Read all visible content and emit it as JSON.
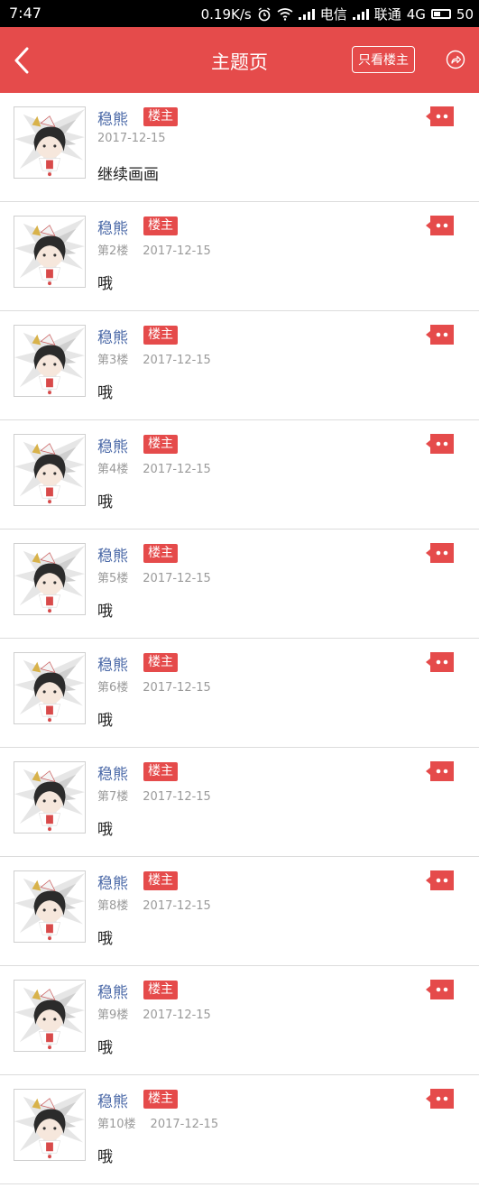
{
  "status_bar": {
    "time": "7:47",
    "speed": "0.19K/s",
    "carrier1": "电信",
    "carrier2": "联通",
    "network": "4G",
    "battery": "50"
  },
  "header": {
    "title": "主题页",
    "only_op_label": "只看楼主",
    "back_icon": "chevron-left-icon",
    "share_icon": "share-icon",
    "bar_color": "#e54b4b"
  },
  "posts": [
    {
      "author": "稳熊",
      "badge": "楼主",
      "floor": "",
      "date": "2017-12-15",
      "content": "继续画画"
    },
    {
      "author": "稳熊",
      "badge": "楼主",
      "floor": "第2楼",
      "date": "2017-12-15",
      "content": "哦"
    },
    {
      "author": "稳熊",
      "badge": "楼主",
      "floor": "第3楼",
      "date": "2017-12-15",
      "content": "哦"
    },
    {
      "author": "稳熊",
      "badge": "楼主",
      "floor": "第4楼",
      "date": "2017-12-15",
      "content": "哦"
    },
    {
      "author": "稳熊",
      "badge": "楼主",
      "floor": "第5楼",
      "date": "2017-12-15",
      "content": "哦"
    },
    {
      "author": "稳熊",
      "badge": "楼主",
      "floor": "第6楼",
      "date": "2017-12-15",
      "content": "哦"
    },
    {
      "author": "稳熊",
      "badge": "楼主",
      "floor": "第7楼",
      "date": "2017-12-15",
      "content": "哦"
    },
    {
      "author": "稳熊",
      "badge": "楼主",
      "floor": "第8楼",
      "date": "2017-12-15",
      "content": "哦"
    },
    {
      "author": "稳熊",
      "badge": "楼主",
      "floor": "第9楼",
      "date": "2017-12-15",
      "content": "哦"
    },
    {
      "author": "稳熊",
      "badge": "楼主",
      "floor": "第10楼",
      "date": "2017-12-15",
      "content": "哦"
    }
  ]
}
